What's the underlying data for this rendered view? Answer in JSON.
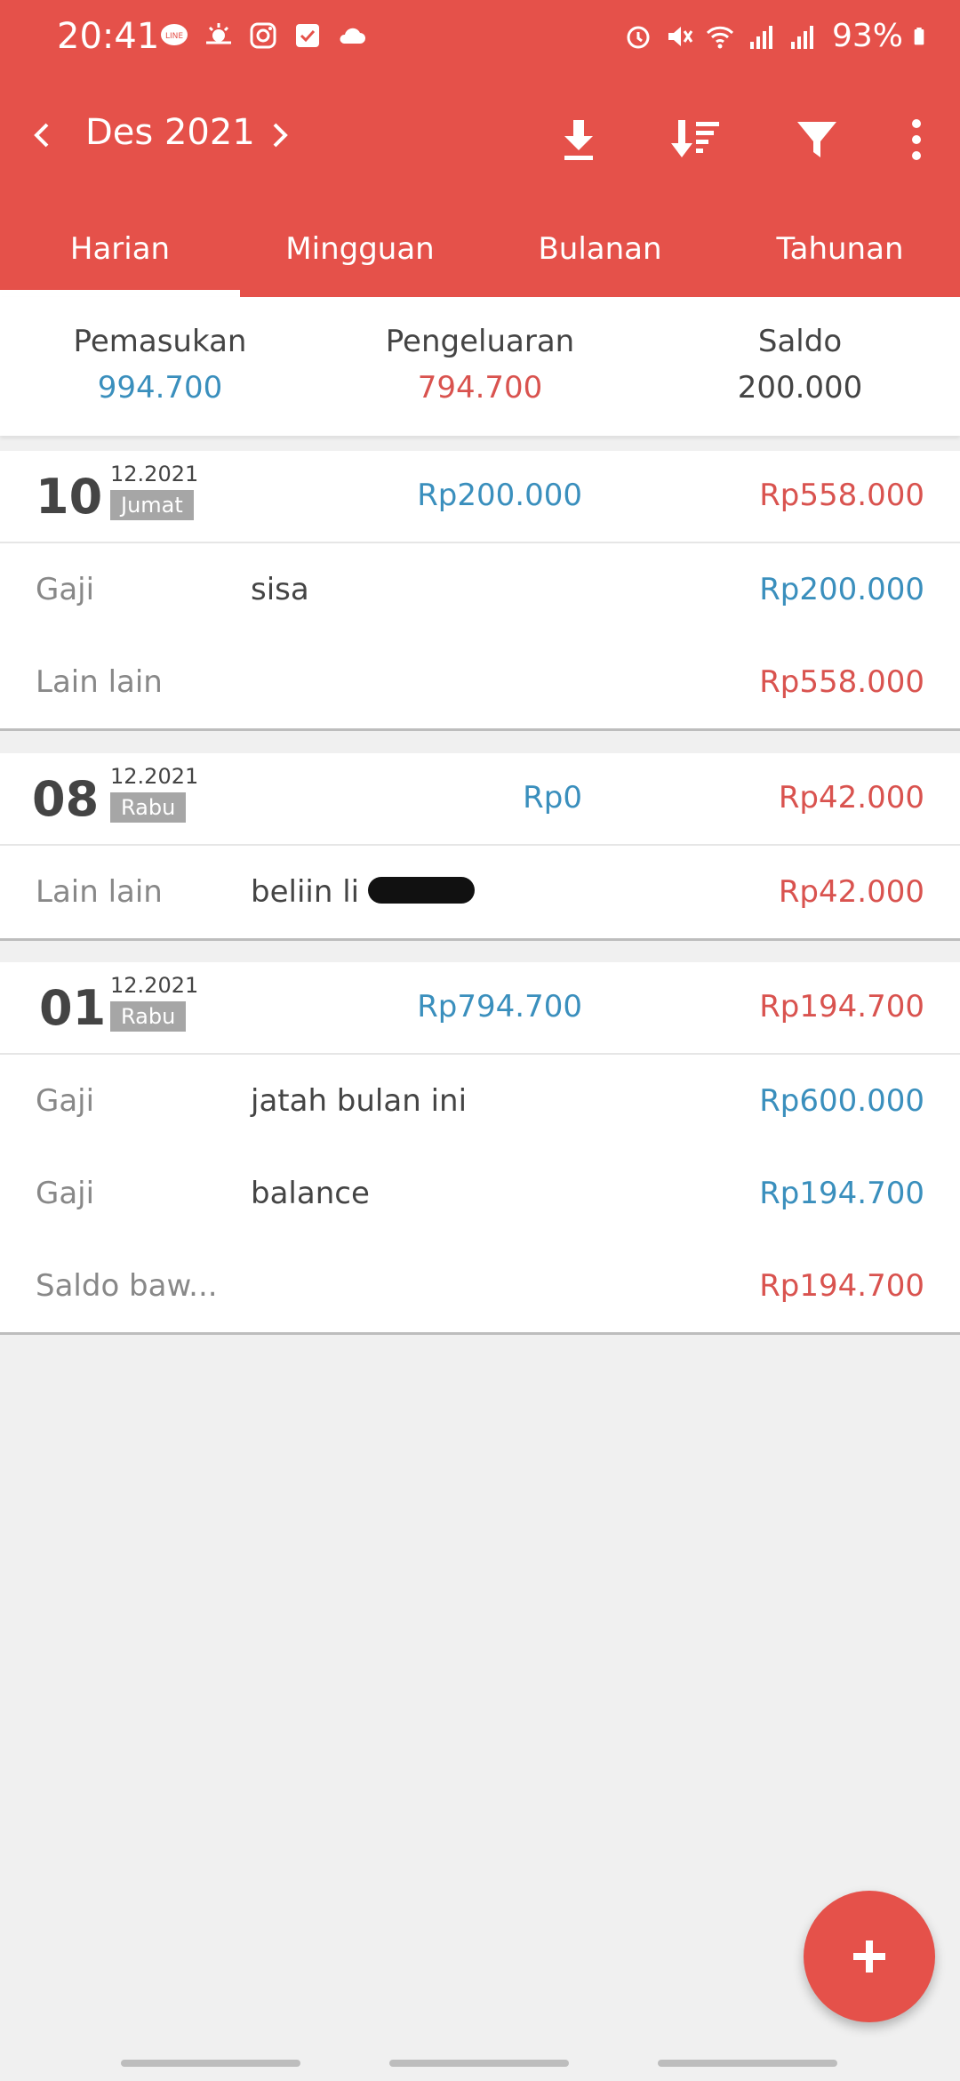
{
  "status_bar": {
    "time": "20:41",
    "battery": "93%",
    "left_icons": [
      "line-icon",
      "weather-icon",
      "instagram-icon",
      "check-icon",
      "cloud-icon"
    ],
    "right_icons": [
      "alarm-icon",
      "mute-icon",
      "wifi-icon",
      "signal-icon",
      "signal-icon",
      "battery-icon"
    ]
  },
  "appbar": {
    "month": "Des 2021",
    "actions": [
      "download-icon",
      "sort-icon",
      "filter-icon",
      "more-icon"
    ]
  },
  "tabs": [
    {
      "label": "Harian",
      "active": true
    },
    {
      "label": "Mingguan",
      "active": false
    },
    {
      "label": "Bulanan",
      "active": false
    },
    {
      "label": "Tahunan",
      "active": false
    }
  ],
  "summary": {
    "income_label": "Pemasukan",
    "income": "994.700",
    "expense_label": "Pengeluaran",
    "expense": "794.700",
    "balance_label": "Saldo",
    "balance": "200.000"
  },
  "days": [
    {
      "day": "10",
      "month_year": "12.2021",
      "weekday": "Jumat",
      "income": "Rp200.000",
      "expense": "Rp558.000",
      "entries": [
        {
          "category": "Gaji",
          "note": "sisa",
          "amount": "Rp200.000",
          "type": "income"
        },
        {
          "category": "Lain lain",
          "note": "",
          "amount": "Rp558.000",
          "type": "expense"
        }
      ]
    },
    {
      "day": "08",
      "month_year": "12.2021",
      "weekday": "Rabu",
      "income": "Rp0",
      "expense": "Rp42.000",
      "entries": [
        {
          "category": "Lain lain",
          "note": "beliin li",
          "amount": "Rp42.000",
          "type": "expense"
        }
      ]
    },
    {
      "day": "01",
      "month_year": "12.2021",
      "weekday": "Rabu",
      "income": "Rp794.700",
      "expense": "Rp194.700",
      "entries": [
        {
          "category": "Gaji",
          "note": "jatah bulan ini",
          "amount": "Rp600.000",
          "type": "income"
        },
        {
          "category": "Gaji",
          "note": "balance",
          "amount": "Rp194.700",
          "type": "income"
        },
        {
          "category": "Saldo baw...",
          "note": "",
          "amount": "Rp194.700",
          "type": "expense"
        }
      ]
    }
  ],
  "fab_icon": "plus-icon",
  "colors": {
    "accent": "#e5514a",
    "income": "#3a8fbd",
    "expense": "#d9534f"
  }
}
